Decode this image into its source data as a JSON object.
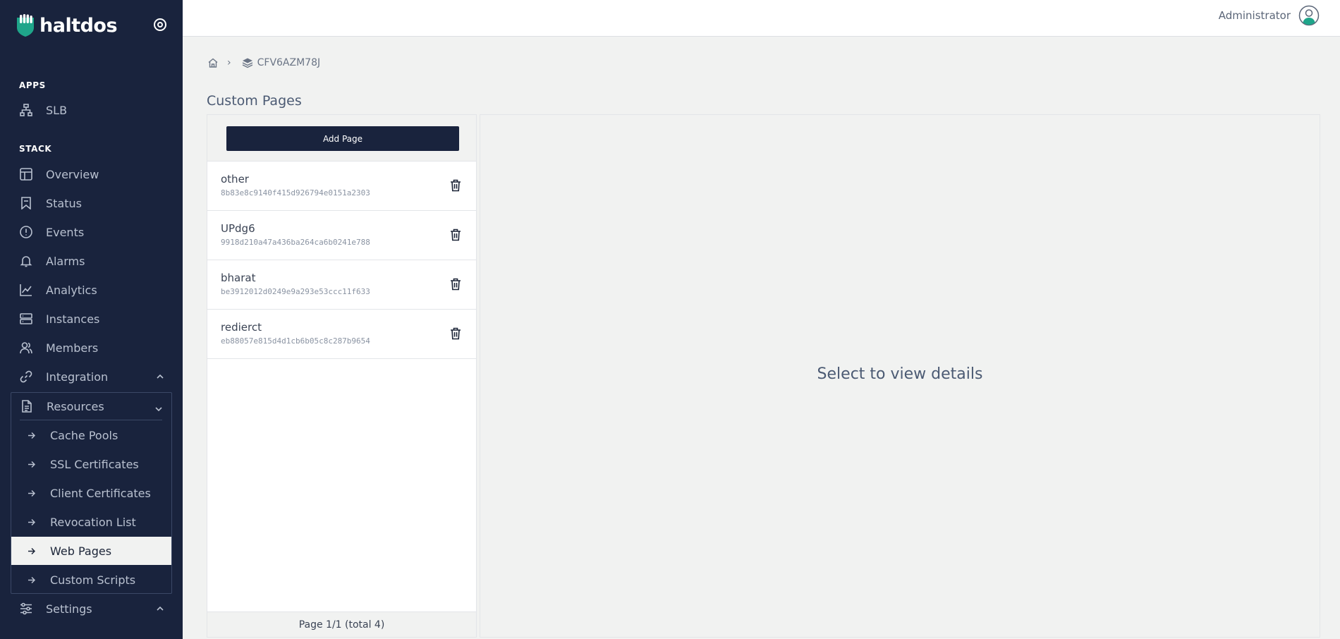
{
  "brand": {
    "name": "haltdos"
  },
  "sidebar": {
    "apps_label": "APPS",
    "apps": [
      {
        "label": "SLB",
        "icon": "sitemap-icon"
      }
    ],
    "stack_label": "STACK",
    "items": [
      {
        "label": "Overview",
        "icon": "layout-icon"
      },
      {
        "label": "Status",
        "icon": "bookmark-icon"
      },
      {
        "label": "Events",
        "icon": "alert-circle-icon"
      },
      {
        "label": "Alarms",
        "icon": "bell-icon"
      },
      {
        "label": "Analytics",
        "icon": "line-chart-icon"
      },
      {
        "label": "Instances",
        "icon": "server-icon"
      },
      {
        "label": "Members",
        "icon": "users-icon"
      },
      {
        "label": "Integration",
        "icon": "link-icon"
      }
    ],
    "resources": {
      "label": "Resources",
      "icon": "file-icon",
      "subitems": [
        {
          "label": "Cache Pools"
        },
        {
          "label": "SSL Certificates"
        },
        {
          "label": "Client Certificates"
        },
        {
          "label": "Revocation List"
        },
        {
          "label": "Web Pages",
          "active": true
        },
        {
          "label": "Custom Scripts"
        }
      ]
    },
    "settings": {
      "label": "Settings",
      "icon": "sliders-icon"
    }
  },
  "header": {
    "user_name": "Administrator"
  },
  "breadcrumb": {
    "stack_id": "CFV6AZM78J"
  },
  "page": {
    "title": "Custom Pages"
  },
  "list": {
    "add_button": "Add Page",
    "rows": [
      {
        "name": "other",
        "hash": "8b83e8c9140f415d926794e0151a2303"
      },
      {
        "name": "UPdg6",
        "hash": "9918d210a47a436ba264ca6b0241e788"
      },
      {
        "name": "bharat",
        "hash": "be3912012d0249e9a293e53ccc11f633"
      },
      {
        "name": "redierct",
        "hash": "eb88057e815d4d1cb6b05c8c287b9654"
      }
    ],
    "pagination": "Page 1/1 (total 4)"
  },
  "detail": {
    "placeholder": "Select to view details"
  },
  "colors": {
    "sidebar_bg": "#19233d",
    "accent_green": "#1fa58a",
    "content_bg": "#f1f2f1"
  }
}
